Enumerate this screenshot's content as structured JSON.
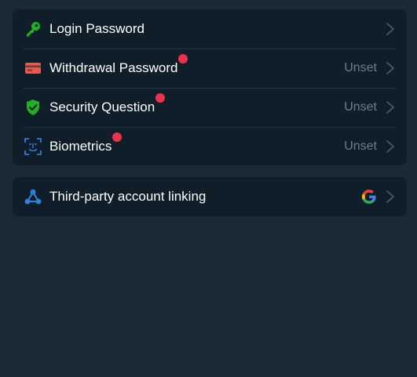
{
  "security": {
    "items": [
      {
        "label": "Login Password",
        "value": "",
        "icon": "key-icon",
        "color": "#21b021"
      },
      {
        "label": "Withdrawal Password",
        "value": "Unset",
        "icon": "card-icon",
        "color": "#e65b4f"
      },
      {
        "label": "Security Question",
        "value": "Unset",
        "icon": "shield-check-icon",
        "color": "#21b021"
      },
      {
        "label": "Biometrics",
        "value": "Unset",
        "icon": "face-id-icon",
        "color": "#2f7fd6"
      }
    ]
  },
  "linking": {
    "label": "Third-party account linking",
    "icon": "network-icon",
    "provider_icon": "google-icon"
  },
  "colors": {
    "background": "#1c2a36",
    "card": "#0f1e28",
    "badge": "#f0304f",
    "muted": "#6e7f8b"
  }
}
